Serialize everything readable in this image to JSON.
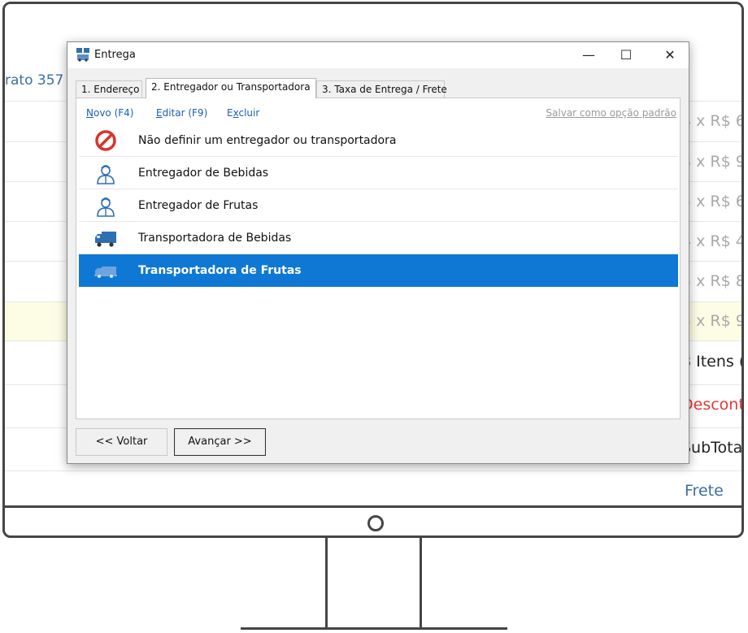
{
  "background": {
    "left_text": "rato 357",
    "right_rows": [
      {
        "text": "4 x R$ 6",
        "style": "gray"
      },
      {
        "text": "3 x R$ 9",
        "style": "gray"
      },
      {
        "text": "5 x R$ 6",
        "style": "gray"
      },
      {
        "text": "4 x R$ 4",
        "style": "gray"
      },
      {
        "text": "5 x R$ 8",
        "style": "gray"
      },
      {
        "text": "5 x R$ 9",
        "style": "gray"
      },
      {
        "text": "8 Itens (",
        "style": "black"
      },
      {
        "text": "Descont",
        "style": "red"
      },
      {
        "text": "SubTota",
        "style": "black"
      },
      {
        "text": "Frete",
        "style": "blue"
      }
    ]
  },
  "dialog": {
    "title": "Entrega",
    "window_controls": {
      "minimize": "—",
      "maximize": "☐",
      "close": "✕"
    },
    "tabs": [
      {
        "label": "1. Endereço"
      },
      {
        "label": "2. Entregador ou Transportadora"
      },
      {
        "label": "3. Taxa de Entrega / Frete"
      }
    ],
    "active_tab": 1,
    "toolbar": {
      "new_label_u": "N",
      "new_label": "ovo (F4)",
      "edit_label_u": "E",
      "edit_label": "ditar (F9)",
      "delete_label_pre": "E",
      "delete_label_u": "x",
      "delete_label": "cluir",
      "save_default": "Salvar como opção padrão"
    },
    "items": [
      {
        "label": "Não definir um entregador ou transportadora",
        "icon": "prohibited-icon"
      },
      {
        "label": "Entregador de Bebidas",
        "icon": "courier-icon"
      },
      {
        "label": "Entregador de Frutas",
        "icon": "courier-icon"
      },
      {
        "label": "Transportadora de Bebidas",
        "icon": "truck-icon"
      },
      {
        "label": "Transportadora de Frutas",
        "icon": "truck-icon"
      }
    ],
    "selected_item": 4,
    "buttons": {
      "back": "<< Voltar",
      "next": "Avançar >>"
    },
    "colors": {
      "selection": "#0f78d4",
      "link": "#1a5fb4",
      "prohibited": "#d9342b",
      "icon_blue": "#2f6fb0"
    }
  }
}
